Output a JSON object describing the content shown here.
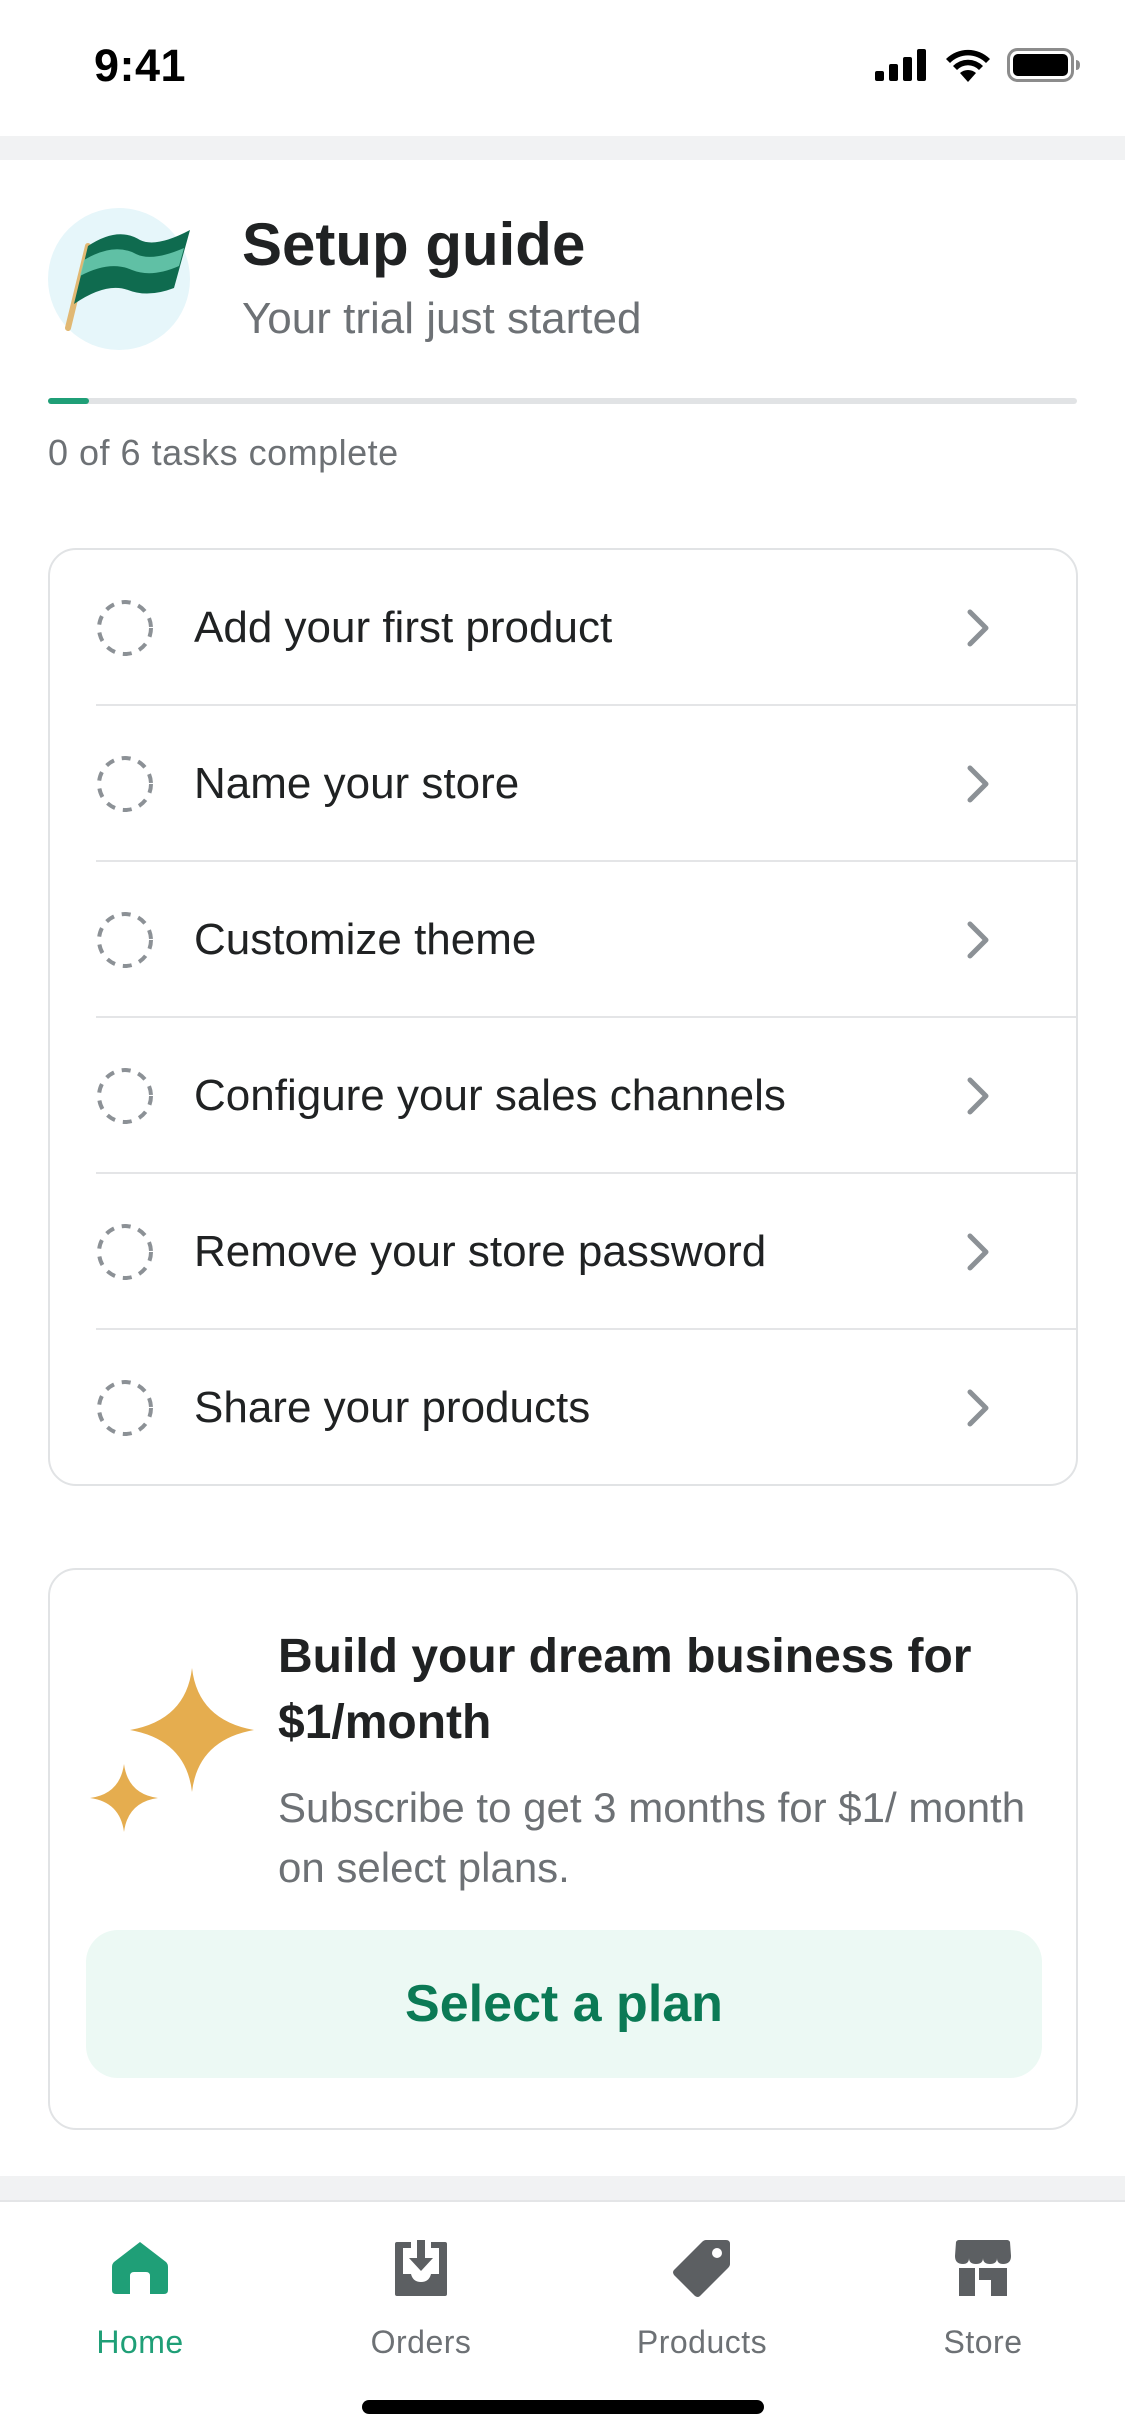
{
  "status_bar": {
    "time": "9:41"
  },
  "setup_guide": {
    "title": "Setup guide",
    "subtitle": "Your trial just started",
    "progress_text": "0 of 6 tasks complete",
    "progress_fraction": 0.04,
    "accent_color": "#1f9f77",
    "icon": "flag-icon"
  },
  "tasks": [
    {
      "label": "Add your first product"
    },
    {
      "label": "Name your store"
    },
    {
      "label": "Customize theme"
    },
    {
      "label": "Configure your sales channels"
    },
    {
      "label": "Remove your store password"
    },
    {
      "label": "Share your products"
    }
  ],
  "promo": {
    "title": "Build your dream business for $1/month",
    "description": "Subscribe to get 3 months for $1/ month on select plans.",
    "button_label": "Select a plan",
    "icon": "sparkle-icon",
    "icon_color": "#e5ad4f"
  },
  "tab_bar": {
    "active": "Home",
    "tabs": [
      {
        "label": "Home",
        "icon": "home-icon"
      },
      {
        "label": "Orders",
        "icon": "orders-icon"
      },
      {
        "label": "Products",
        "icon": "tag-icon"
      },
      {
        "label": "Store",
        "icon": "store-icon"
      }
    ]
  }
}
